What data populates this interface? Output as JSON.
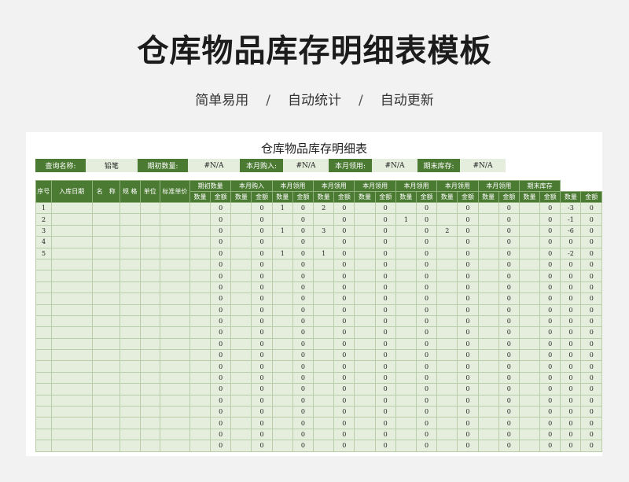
{
  "hero": {
    "title": "仓库物品库存明细表模板",
    "tags": [
      "简单易用",
      "自动统计",
      "自动更新"
    ],
    "separator": "/"
  },
  "sheet": {
    "title": "仓库物品库存明细表",
    "query": [
      {
        "label": "查询名称:",
        "value": "铅笔"
      },
      {
        "label": "期初数量:",
        "value": "#N/A"
      },
      {
        "label": "本月购入:",
        "value": "#N/A"
      },
      {
        "label": "本月领用:",
        "value": "#N/A"
      },
      {
        "label": "期末库存:",
        "value": "#N/A"
      }
    ],
    "header_top": [
      "序号",
      "入库日期",
      "名　称",
      "规 格",
      "单位",
      "标准单价",
      "期初数量",
      "本月购入",
      "本月领用",
      "本月领用",
      "本月领用",
      "本月领用",
      "本月领用",
      "本月领用",
      "期末库存"
    ],
    "header_sub": [
      "数量",
      "金额"
    ],
    "rows": [
      [
        "1",
        "",
        "",
        "",
        "",
        "",
        "",
        "0",
        "",
        "0",
        "1",
        "0",
        "2",
        "0",
        "",
        "0",
        "",
        "0",
        "",
        "0",
        "",
        "0",
        "",
        "0",
        "-3",
        "0"
      ],
      [
        "2",
        "",
        "",
        "",
        "",
        "",
        "",
        "0",
        "",
        "0",
        "",
        "0",
        "",
        "0",
        "",
        "0",
        "1",
        "0",
        "",
        "0",
        "",
        "0",
        "",
        "0",
        "-1",
        "0"
      ],
      [
        "3",
        "",
        "",
        "",
        "",
        "",
        "",
        "0",
        "",
        "0",
        "1",
        "0",
        "3",
        "0",
        "",
        "0",
        "",
        "0",
        "2",
        "0",
        "",
        "0",
        "",
        "0",
        "-6",
        "0"
      ],
      [
        "4",
        "",
        "",
        "",
        "",
        "",
        "",
        "0",
        "",
        "0",
        "",
        "0",
        "",
        "0",
        "",
        "0",
        "",
        "0",
        "",
        "0",
        "",
        "0",
        "",
        "0",
        "0",
        "0"
      ],
      [
        "5",
        "",
        "",
        "",
        "",
        "",
        "",
        "0",
        "",
        "0",
        "1",
        "0",
        "1",
        "0",
        "",
        "0",
        "",
        "0",
        "",
        "0",
        "",
        "0",
        "",
        "0",
        "-2",
        "0"
      ],
      [
        "",
        "",
        "",
        "",
        "",
        "",
        "",
        "0",
        "",
        "0",
        "",
        "0",
        "",
        "0",
        "",
        "0",
        "",
        "0",
        "",
        "0",
        "",
        "0",
        "",
        "0",
        "0",
        "0"
      ],
      [
        "",
        "",
        "",
        "",
        "",
        "",
        "",
        "0",
        "",
        "0",
        "",
        "0",
        "",
        "0",
        "",
        "0",
        "",
        "0",
        "",
        "0",
        "",
        "0",
        "",
        "0",
        "0",
        "0"
      ],
      [
        "",
        "",
        "",
        "",
        "",
        "",
        "",
        "0",
        "",
        "0",
        "",
        "0",
        "",
        "0",
        "",
        "0",
        "",
        "0",
        "",
        "0",
        "",
        "0",
        "",
        "0",
        "0",
        "0"
      ],
      [
        "",
        "",
        "",
        "",
        "",
        "",
        "",
        "0",
        "",
        "0",
        "",
        "0",
        "",
        "0",
        "",
        "0",
        "",
        "0",
        "",
        "0",
        "",
        "0",
        "",
        "0",
        "0",
        "0"
      ],
      [
        "",
        "",
        "",
        "",
        "",
        "",
        "",
        "0",
        "",
        "0",
        "",
        "0",
        "",
        "0",
        "",
        "0",
        "",
        "0",
        "",
        "0",
        "",
        "0",
        "",
        "0",
        "0",
        "0"
      ],
      [
        "",
        "",
        "",
        "",
        "",
        "",
        "",
        "0",
        "",
        "0",
        "",
        "0",
        "",
        "0",
        "",
        "0",
        "",
        "0",
        "",
        "0",
        "",
        "0",
        "",
        "0",
        "0",
        "0"
      ],
      [
        "",
        "",
        "",
        "",
        "",
        "",
        "",
        "0",
        "",
        "0",
        "",
        "0",
        "",
        "0",
        "",
        "0",
        "",
        "0",
        "",
        "0",
        "",
        "0",
        "",
        "0",
        "0",
        "0"
      ],
      [
        "",
        "",
        "",
        "",
        "",
        "",
        "",
        "0",
        "",
        "0",
        "",
        "0",
        "",
        "0",
        "",
        "0",
        "",
        "0",
        "",
        "0",
        "",
        "0",
        "",
        "0",
        "0",
        "0"
      ],
      [
        "",
        "",
        "",
        "",
        "",
        "",
        "",
        "0",
        "",
        "0",
        "",
        "0",
        "",
        "0",
        "",
        "0",
        "",
        "0",
        "",
        "0",
        "",
        "0",
        "",
        "0",
        "0",
        "0"
      ],
      [
        "",
        "",
        "",
        "",
        "",
        "",
        "",
        "0",
        "",
        "0",
        "",
        "0",
        "",
        "0",
        "",
        "0",
        "",
        "0",
        "",
        "0",
        "",
        "0",
        "",
        "0",
        "0",
        "0"
      ],
      [
        "",
        "",
        "",
        "",
        "",
        "",
        "",
        "0",
        "",
        "0",
        "",
        "0",
        "",
        "0",
        "",
        "0",
        "",
        "0",
        "",
        "0",
        "",
        "0",
        "",
        "0",
        "0",
        "0"
      ],
      [
        "",
        "",
        "",
        "",
        "",
        "",
        "",
        "0",
        "",
        "0",
        "",
        "0",
        "",
        "0",
        "",
        "0",
        "",
        "0",
        "",
        "0",
        "",
        "0",
        "",
        "0",
        "0",
        "0"
      ],
      [
        "",
        "",
        "",
        "",
        "",
        "",
        "",
        "0",
        "",
        "0",
        "",
        "0",
        "",
        "0",
        "",
        "0",
        "",
        "0",
        "",
        "0",
        "",
        "0",
        "",
        "0",
        "0",
        "0"
      ],
      [
        "",
        "",
        "",
        "",
        "",
        "",
        "",
        "0",
        "",
        "0",
        "",
        "0",
        "",
        "0",
        "",
        "0",
        "",
        "0",
        "",
        "0",
        "",
        "0",
        "",
        "0",
        "0",
        "0"
      ],
      [
        "",
        "",
        "",
        "",
        "",
        "",
        "",
        "0",
        "",
        "0",
        "",
        "0",
        "",
        "0",
        "",
        "0",
        "",
        "0",
        "",
        "0",
        "",
        "0",
        "",
        "0",
        "0",
        "0"
      ],
      [
        "",
        "",
        "",
        "",
        "",
        "",
        "",
        "0",
        "",
        "0",
        "",
        "0",
        "",
        "0",
        "",
        "0",
        "",
        "0",
        "",
        "0",
        "",
        "0",
        "",
        "0",
        "0",
        "0"
      ],
      [
        "",
        "",
        "",
        "",
        "",
        "",
        "",
        "0",
        "",
        "0",
        "",
        "0",
        "",
        "0",
        "",
        "0",
        "",
        "0",
        "",
        "0",
        "",
        "0",
        "",
        "0",
        "0",
        "0"
      ]
    ]
  },
  "colors": {
    "header_green": "#4b7a32",
    "cell_green": "#e5eedd",
    "background": "#f2f2f2"
  }
}
